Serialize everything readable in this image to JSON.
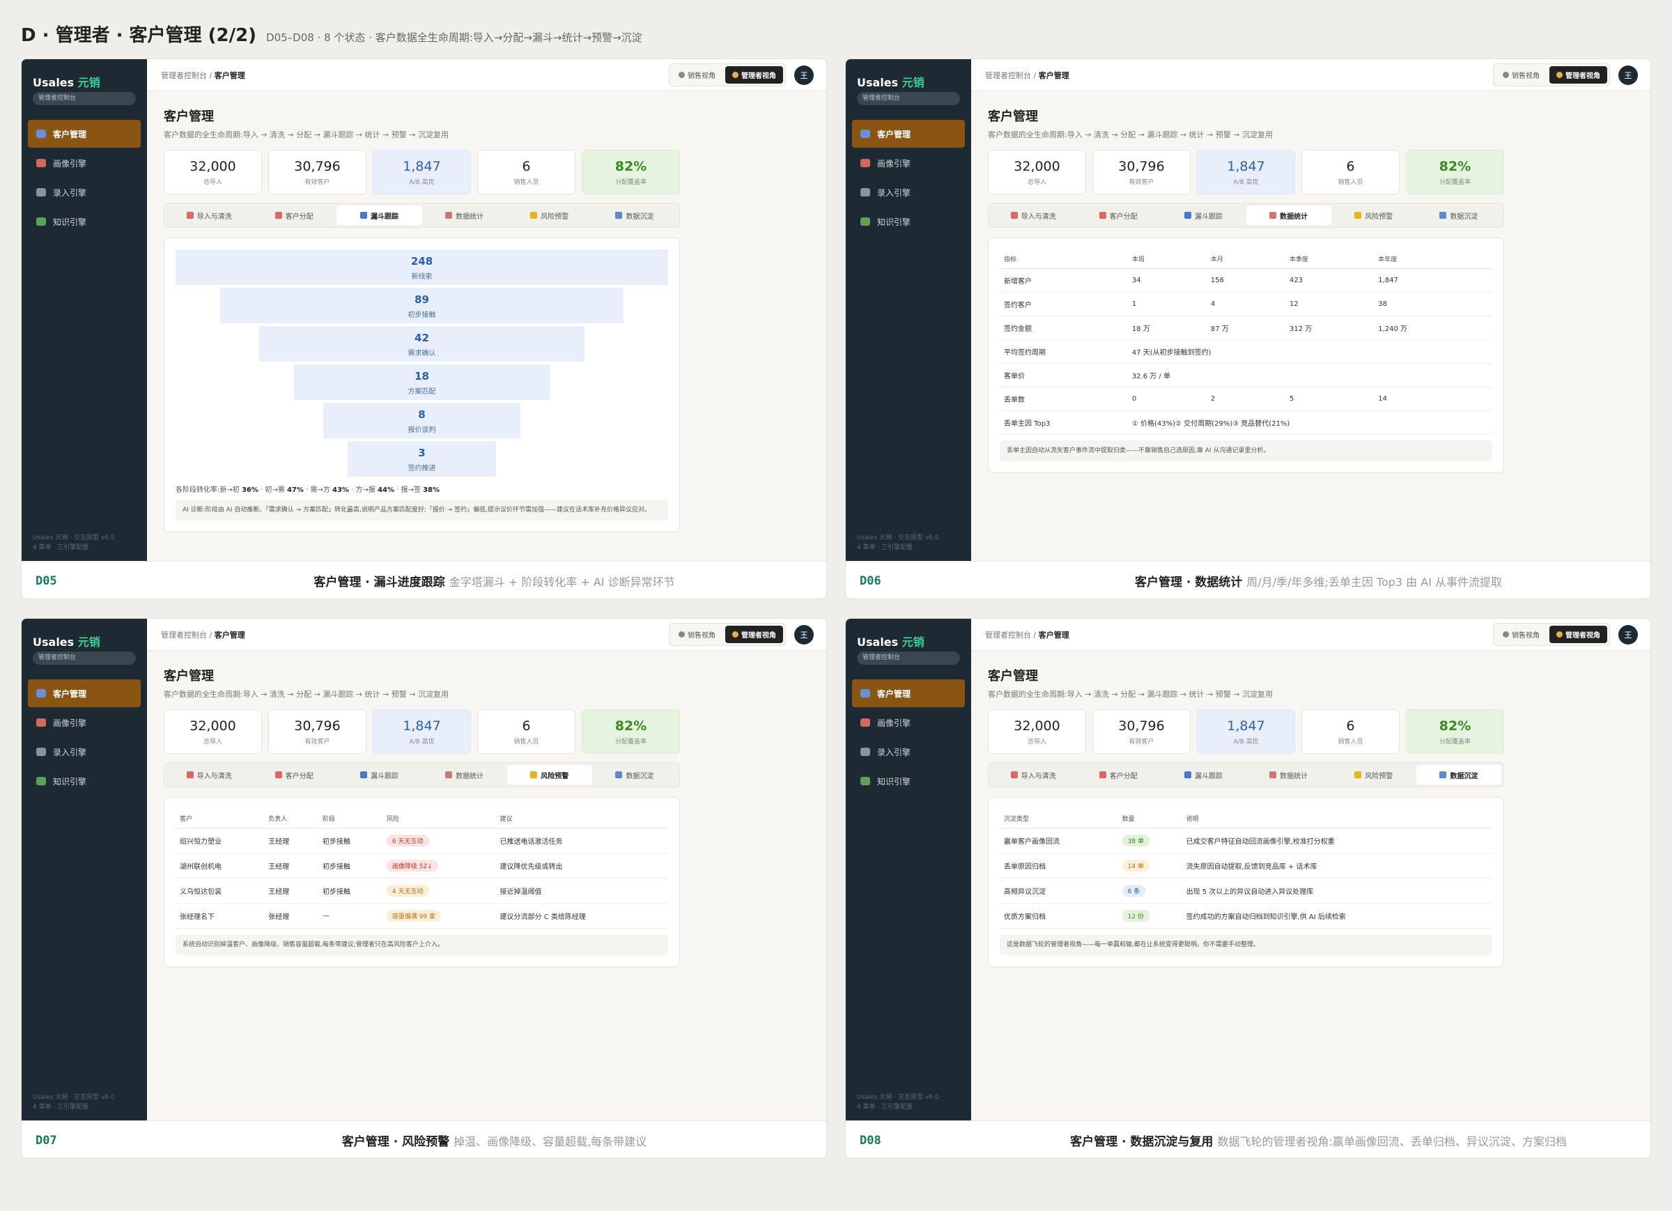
{
  "page": {
    "title": "D · 管理者 · 客户管理 (2/2)",
    "subtitle": "D05–D08 · 8 个状态 · 客户数据全生命周期:导入→分配→漏斗→统计→预警→沉淀"
  },
  "common": {
    "logo_main": "Usales",
    "logo_accent": "元销",
    "role_pill": "管理者控制台",
    "nav": [
      "客户管理",
      "画像引擎",
      "录入引擎",
      "知识引擎"
    ],
    "nav_foot_1": "Usales 元销 · 交互原型 v6.0",
    "nav_foot_2": "4 菜单 · 三引擎配置",
    "crumb_parent": "管理者控制台 / ",
    "crumb_current": "客户管理",
    "toggle_sales": "销售视角",
    "toggle_manager": "管理者视角",
    "avatar": "王",
    "heading": "客户管理",
    "description": "客户数据的全生命周期:导入 → 清洗 → 分配 → 漏斗跟踪 → 统计 → 预警 → 沉淀复用",
    "stats": [
      {
        "value": "32,000",
        "label": "总导入"
      },
      {
        "value": "30,796",
        "label": "有效客户"
      },
      {
        "value": "1,847",
        "label": "A/B 高优"
      },
      {
        "value": "6",
        "label": "销售人员"
      },
      {
        "value": "82%",
        "label": "分配覆盖率"
      }
    ],
    "tabs": [
      "导入与清洗",
      "客户分配",
      "漏斗跟踪",
      "数据统计",
      "风险预警",
      "数据沉淀"
    ],
    "colors": {
      "sidebar": "#1e2a33",
      "active_nav": "#8a5513",
      "accent_green": "#3ccf91",
      "kpi_blue": "#e8effa",
      "kpi_green": "#e6f3de"
    }
  },
  "d05": {
    "id": "D05",
    "cap_title": "客户管理 · 漏斗进度跟踪",
    "cap_desc": "金字塔漏斗 + 阶段转化率 + AI 诊断异常环节",
    "funnel": [
      {
        "n": "248",
        "t": "新线索"
      },
      {
        "n": "89",
        "t": "初步接触"
      },
      {
        "n": "42",
        "t": "需求确认"
      },
      {
        "n": "18",
        "t": "方案匹配"
      },
      {
        "n": "8",
        "t": "报价谈判"
      },
      {
        "n": "3",
        "t": "签约推进"
      }
    ],
    "rates_prefix": "各阶段转化率:新→初 ",
    "rates": [
      "36%",
      "47%",
      "43%",
      "44%",
      "38%"
    ],
    "rates_sep": [
      " · 初→需 ",
      " · 需→方 ",
      " · 方→报 ",
      " · 报→签 "
    ],
    "note": "AI 诊断:阶段由 AI 自动推断。「需求确认 → 方案匹配」转化最高,说明产品方案匹配度好;「报价 → 签约」偏低,提示议价环节需加强——建议在话术库补充价格异议应对。"
  },
  "d06": {
    "id": "D06",
    "cap_title": "客户管理 · 数据统计",
    "cap_desc": "周/月/季/年多维;丢单主因 Top3 由 AI 从事件流提取",
    "headers": [
      "指标",
      "本周",
      "本月",
      "本季度",
      "本年度"
    ],
    "rows": [
      [
        "新增客户",
        "34",
        "156",
        "423",
        "1,847"
      ],
      [
        "签约客户",
        "1",
        "4",
        "12",
        "38"
      ],
      [
        "签约金额",
        "18 万",
        "87 万",
        "312 万",
        "1,240 万"
      ],
      [
        "平均签约周期",
        "47 天(从初步接触到签约)",
        "",
        "",
        ""
      ],
      [
        "客单价",
        "32.6 万 / 单",
        "",
        "",
        ""
      ],
      [
        "丢单数",
        "0",
        "2",
        "5",
        "14"
      ],
      [
        "丢单主因 Top3",
        "① 价格(43%)② 交付周期(29%)③ 竞品替代(21%)",
        "",
        "",
        ""
      ]
    ],
    "note": "丢单主因自动从流失客户事件流中提取归类——不靠销售自己选原因,靠 AI 从沟通记录里分析。"
  },
  "d07": {
    "id": "D07",
    "cap_title": "客户管理 · 风险预警",
    "cap_desc": "掉温、画像降级、容量超载,每条带建议",
    "headers": [
      "客户",
      "负责人",
      "阶段",
      "风险",
      "建议"
    ],
    "rows": [
      {
        "c": "绍兴恒力塑业",
        "o": "王经理",
        "s": "初步接触",
        "r": "6 天无互动",
        "k": "red",
        "a": "已推送电话激活任务"
      },
      {
        "c": "湖州联创机电",
        "o": "王经理",
        "s": "初步接触",
        "r": "画像降级 52↓",
        "k": "red",
        "a": "建议降优先级或转出"
      },
      {
        "c": "义乌恒达包装",
        "o": "王经理",
        "s": "初步接触",
        "r": "4 天无互动",
        "k": "org",
        "a": "接近掉温阈值"
      },
      {
        "c": "张经理名下",
        "o": "张经理",
        "s": "—",
        "r": "容量偏满 99 家",
        "k": "org",
        "a": "建议分流部分 C 类给陈经理"
      }
    ],
    "note": "系统自动识别掉温客户、画像降级、销售容量超载,每条带建议;管理者只在高风险客户上介入。"
  },
  "d08": {
    "id": "D08",
    "cap_title": "客户管理 · 数据沉淀与复用",
    "cap_desc": "数据飞轮的管理者视角:赢单画像回流、丢单归档、异议沉淀、方案归档",
    "headers": [
      "沉淀类型",
      "数量",
      "说明"
    ],
    "rows": [
      {
        "t": "赢单客户画像回流",
        "n": "38 单",
        "k": "green",
        "d": "已成交客户特征自动回流画像引擎,校准打分权重"
      },
      {
        "t": "丢单原因归档",
        "n": "14 单",
        "k": "org",
        "d": "流失原因自动提取,反馈到竞品库 + 话术库"
      },
      {
        "t": "高频异议沉淀",
        "n": "6 条",
        "k": "blue",
        "d": "出现 5 次以上的异议自动进入异议处理库"
      },
      {
        "t": "优质方案归档",
        "n": "12 份",
        "k": "green",
        "d": "签约成功的方案自动归档到知识引擎,供 AI 后续检索"
      }
    ],
    "note": "这是数据飞轮的管理者视角——每一单赢和输,都在让系统变得更聪明。你不需要手动整理。"
  }
}
